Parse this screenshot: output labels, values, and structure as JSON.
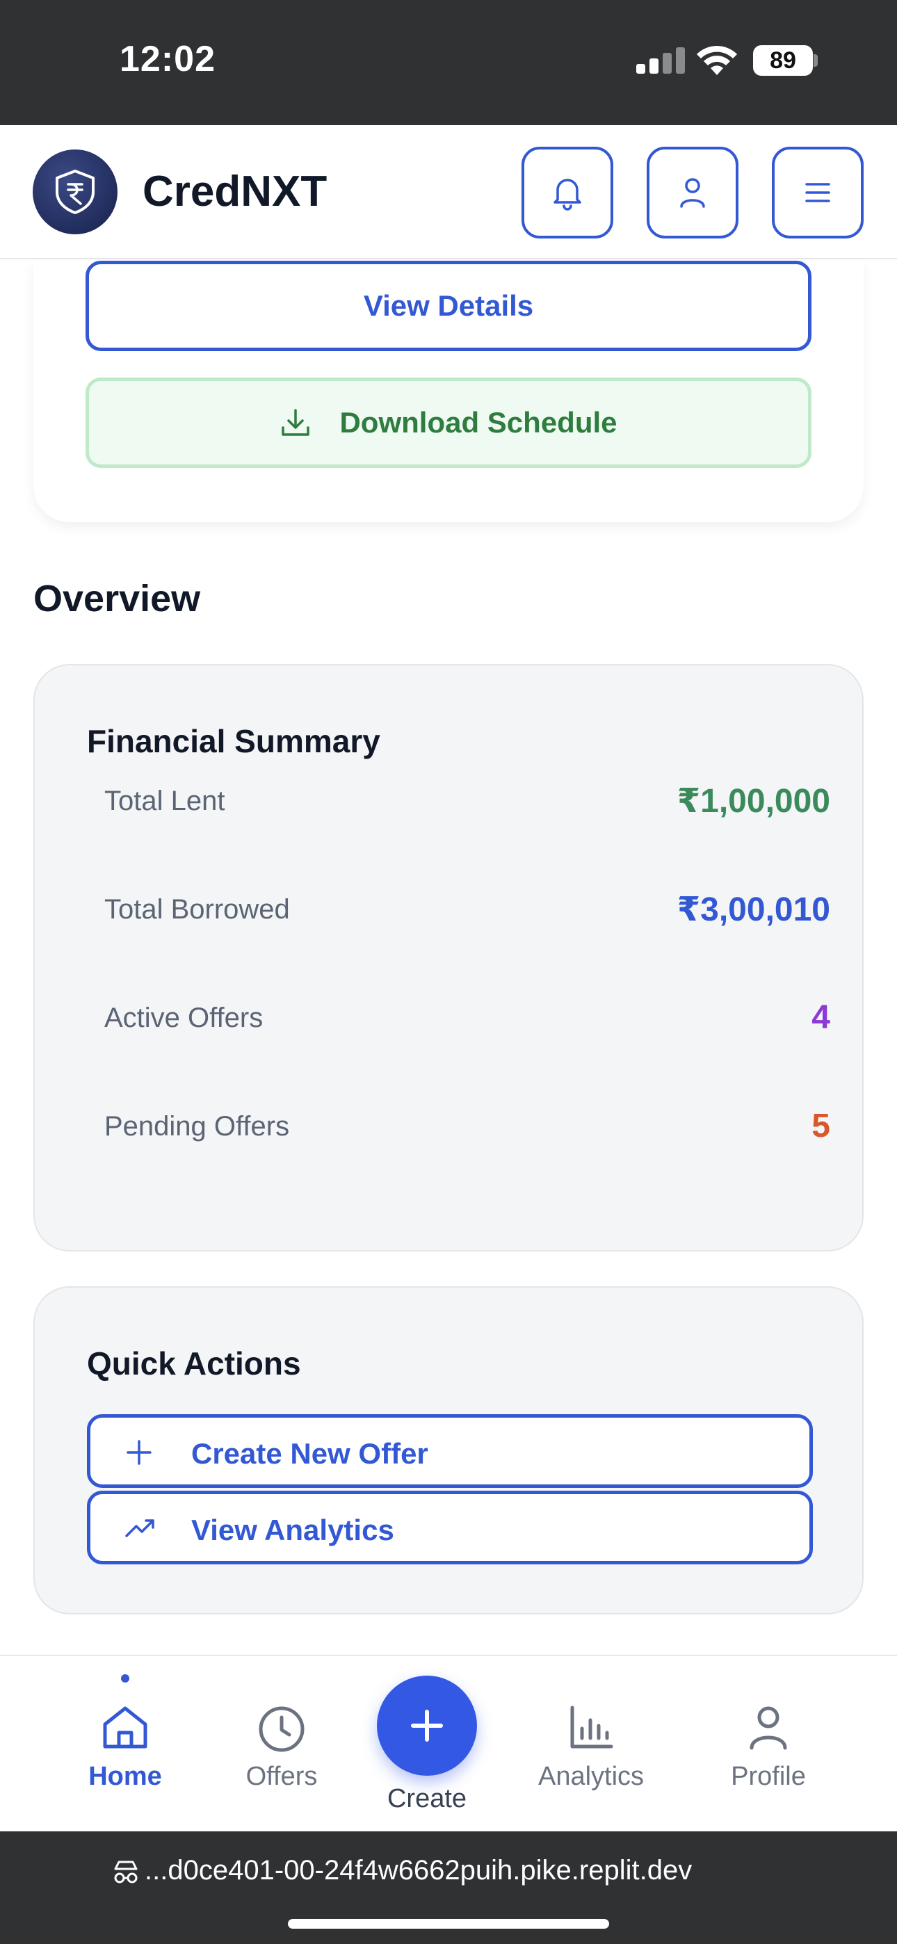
{
  "status_bar": {
    "time": "12:02",
    "battery": "89"
  },
  "header": {
    "brand": "CredNXT"
  },
  "top_card": {
    "view_details": "View Details",
    "download_schedule": "Download Schedule"
  },
  "overview": {
    "title": "Overview"
  },
  "financial_summary": {
    "title": "Financial Summary",
    "rows": [
      {
        "label": "Total Lent",
        "value": "₹1,00,000",
        "color": "#3a8a5c"
      },
      {
        "label": "Total Borrowed",
        "value": "₹3,00,010",
        "color": "#3358d4"
      },
      {
        "label": "Active Offers",
        "value": "4",
        "color": "#8a3ad6"
      },
      {
        "label": "Pending Offers",
        "value": "5",
        "color": "#d9582b"
      }
    ]
  },
  "quick_actions": {
    "title": "Quick Actions",
    "create_new_offer": "Create New Offer",
    "view_analytics": "View Analytics"
  },
  "bottom_nav": {
    "home": "Home",
    "offers": "Offers",
    "create": "Create",
    "analytics": "Analytics",
    "profile": "Profile",
    "active": "home"
  },
  "browser": {
    "url": "...d0ce401-00-24f4w6662puih.pike.replit.dev"
  },
  "colors": {
    "accent": "#3358d4",
    "success": "#2e7d3e"
  }
}
